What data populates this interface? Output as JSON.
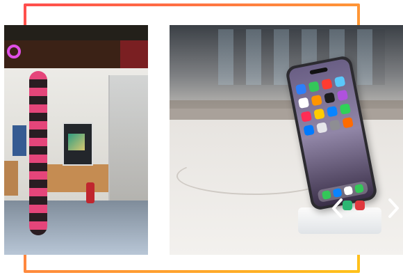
{
  "gallery": {
    "frame": {
      "gradient_colors": [
        "#ff4d4d",
        "#ff8a3d",
        "#ffc21a"
      ]
    },
    "slides": [
      {
        "name": "store-front-photo"
      },
      {
        "name": "phone-display-photo"
      }
    ],
    "controls": {
      "prev_icon": "chevron-left-icon",
      "next_icon": "chevron-right-icon"
    }
  },
  "colors": {
    "store_logo": "#e04fe6",
    "balloon_pink": "#e5457a",
    "balloon_dark": "#2a1d22"
  }
}
